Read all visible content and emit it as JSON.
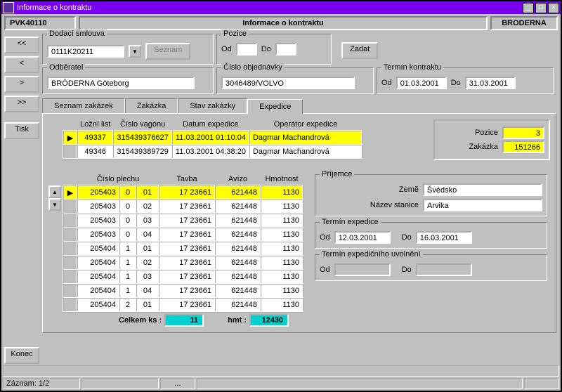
{
  "window": {
    "title": "Informace o kontraktu",
    "code": "PVK40110",
    "center_title": "Informace o kontraktu",
    "right_title": "BRODERNA"
  },
  "nav": {
    "first": "<<",
    "prev": "<",
    "next": ">",
    "last": ">>",
    "print": "Tisk",
    "close": "Konec"
  },
  "supply": {
    "label": "Dodací smlouva",
    "value": "0111K20211",
    "list_btn": "Seznam"
  },
  "position": {
    "label": "Pozice",
    "from_lbl": "Od",
    "to_lbl": "Do",
    "from": "",
    "to": "",
    "submit": "Zadat"
  },
  "customer": {
    "label": "Odběratel",
    "value": "BRÖDERNA Göteborg"
  },
  "order": {
    "label": "Číslo objednávky",
    "value": "3046489/VOLVO"
  },
  "contract_term": {
    "label": "Termín kontraktu",
    "from_lbl": "Od",
    "to_lbl": "Do",
    "from": "01.03.2001",
    "to": "31.03.2001"
  },
  "tabs": {
    "t1": "Seznam zakázek",
    "t2": "Zakázka",
    "t3": "Stav zakázky",
    "t4": "Expedice"
  },
  "exp_table": {
    "h": {
      "c1": "Ložní list",
      "c2": "Číslo vagónu",
      "c3": "Datum expedice",
      "c4": "Operátor expedice"
    },
    "rows": [
      {
        "c1": "49337",
        "c2": "315439376627",
        "c3": "11.03.2001 01:10:04",
        "c4": "Dagmar Machandrová"
      },
      {
        "c1": "49346",
        "c2": "315439389729",
        "c3": "11.03.2001 04:38:20",
        "c4": "Dagmar Machandrová"
      }
    ]
  },
  "sheet_table": {
    "h": {
      "c1": "Číslo plechu",
      "c2": "Tavba",
      "c3": "Avízo",
      "c4": "Hmotnost"
    },
    "rows": [
      {
        "a": "205403",
        "b": "0",
        "c": "01",
        "d": "17 23661",
        "e": "621448",
        "f": "1130"
      },
      {
        "a": "205403",
        "b": "0",
        "c": "02",
        "d": "17 23661",
        "e": "621448",
        "f": "1130"
      },
      {
        "a": "205403",
        "b": "0",
        "c": "03",
        "d": "17 23661",
        "e": "621448",
        "f": "1130"
      },
      {
        "a": "205403",
        "b": "0",
        "c": "04",
        "d": "17 23661",
        "e": "621448",
        "f": "1130"
      },
      {
        "a": "205404",
        "b": "1",
        "c": "01",
        "d": "17 23661",
        "e": "621448",
        "f": "1130"
      },
      {
        "a": "205404",
        "b": "1",
        "c": "02",
        "d": "17 23661",
        "e": "621448",
        "f": "1130"
      },
      {
        "a": "205404",
        "b": "1",
        "c": "03",
        "d": "17 23661",
        "e": "621448",
        "f": "1130"
      },
      {
        "a": "205404",
        "b": "1",
        "c": "04",
        "d": "17 23661",
        "e": "621448",
        "f": "1130"
      },
      {
        "a": "205404",
        "b": "2",
        "c": "01",
        "d": "17 23661",
        "e": "621448",
        "f": "1130"
      }
    ],
    "tot_ks_lbl": "Celkem ks :",
    "tot_ks": "11",
    "tot_hmt_lbl": "hmt :",
    "tot_hmt": "12430"
  },
  "recipient": {
    "label": "Příjemce",
    "country_lbl": "Země",
    "country": "Švédsko",
    "station_lbl": "Název stanice",
    "station": "Arvika"
  },
  "ship_term": {
    "label": "Termín expedice",
    "from_lbl": "Od",
    "from": "12.03.2001",
    "to_lbl": "Do",
    "to": "16.03.2001"
  },
  "release_term": {
    "label": "Termín expedičního uvolnění",
    "from_lbl": "Od",
    "from": "",
    "to_lbl": "Do",
    "to": ""
  },
  "sideinfo": {
    "pos_lbl": "Pozice",
    "pos": "3",
    "ord_lbl": "Zakázka",
    "ord": "151266"
  },
  "status": {
    "record": "Záznam: 1/2",
    "dots": "..."
  }
}
